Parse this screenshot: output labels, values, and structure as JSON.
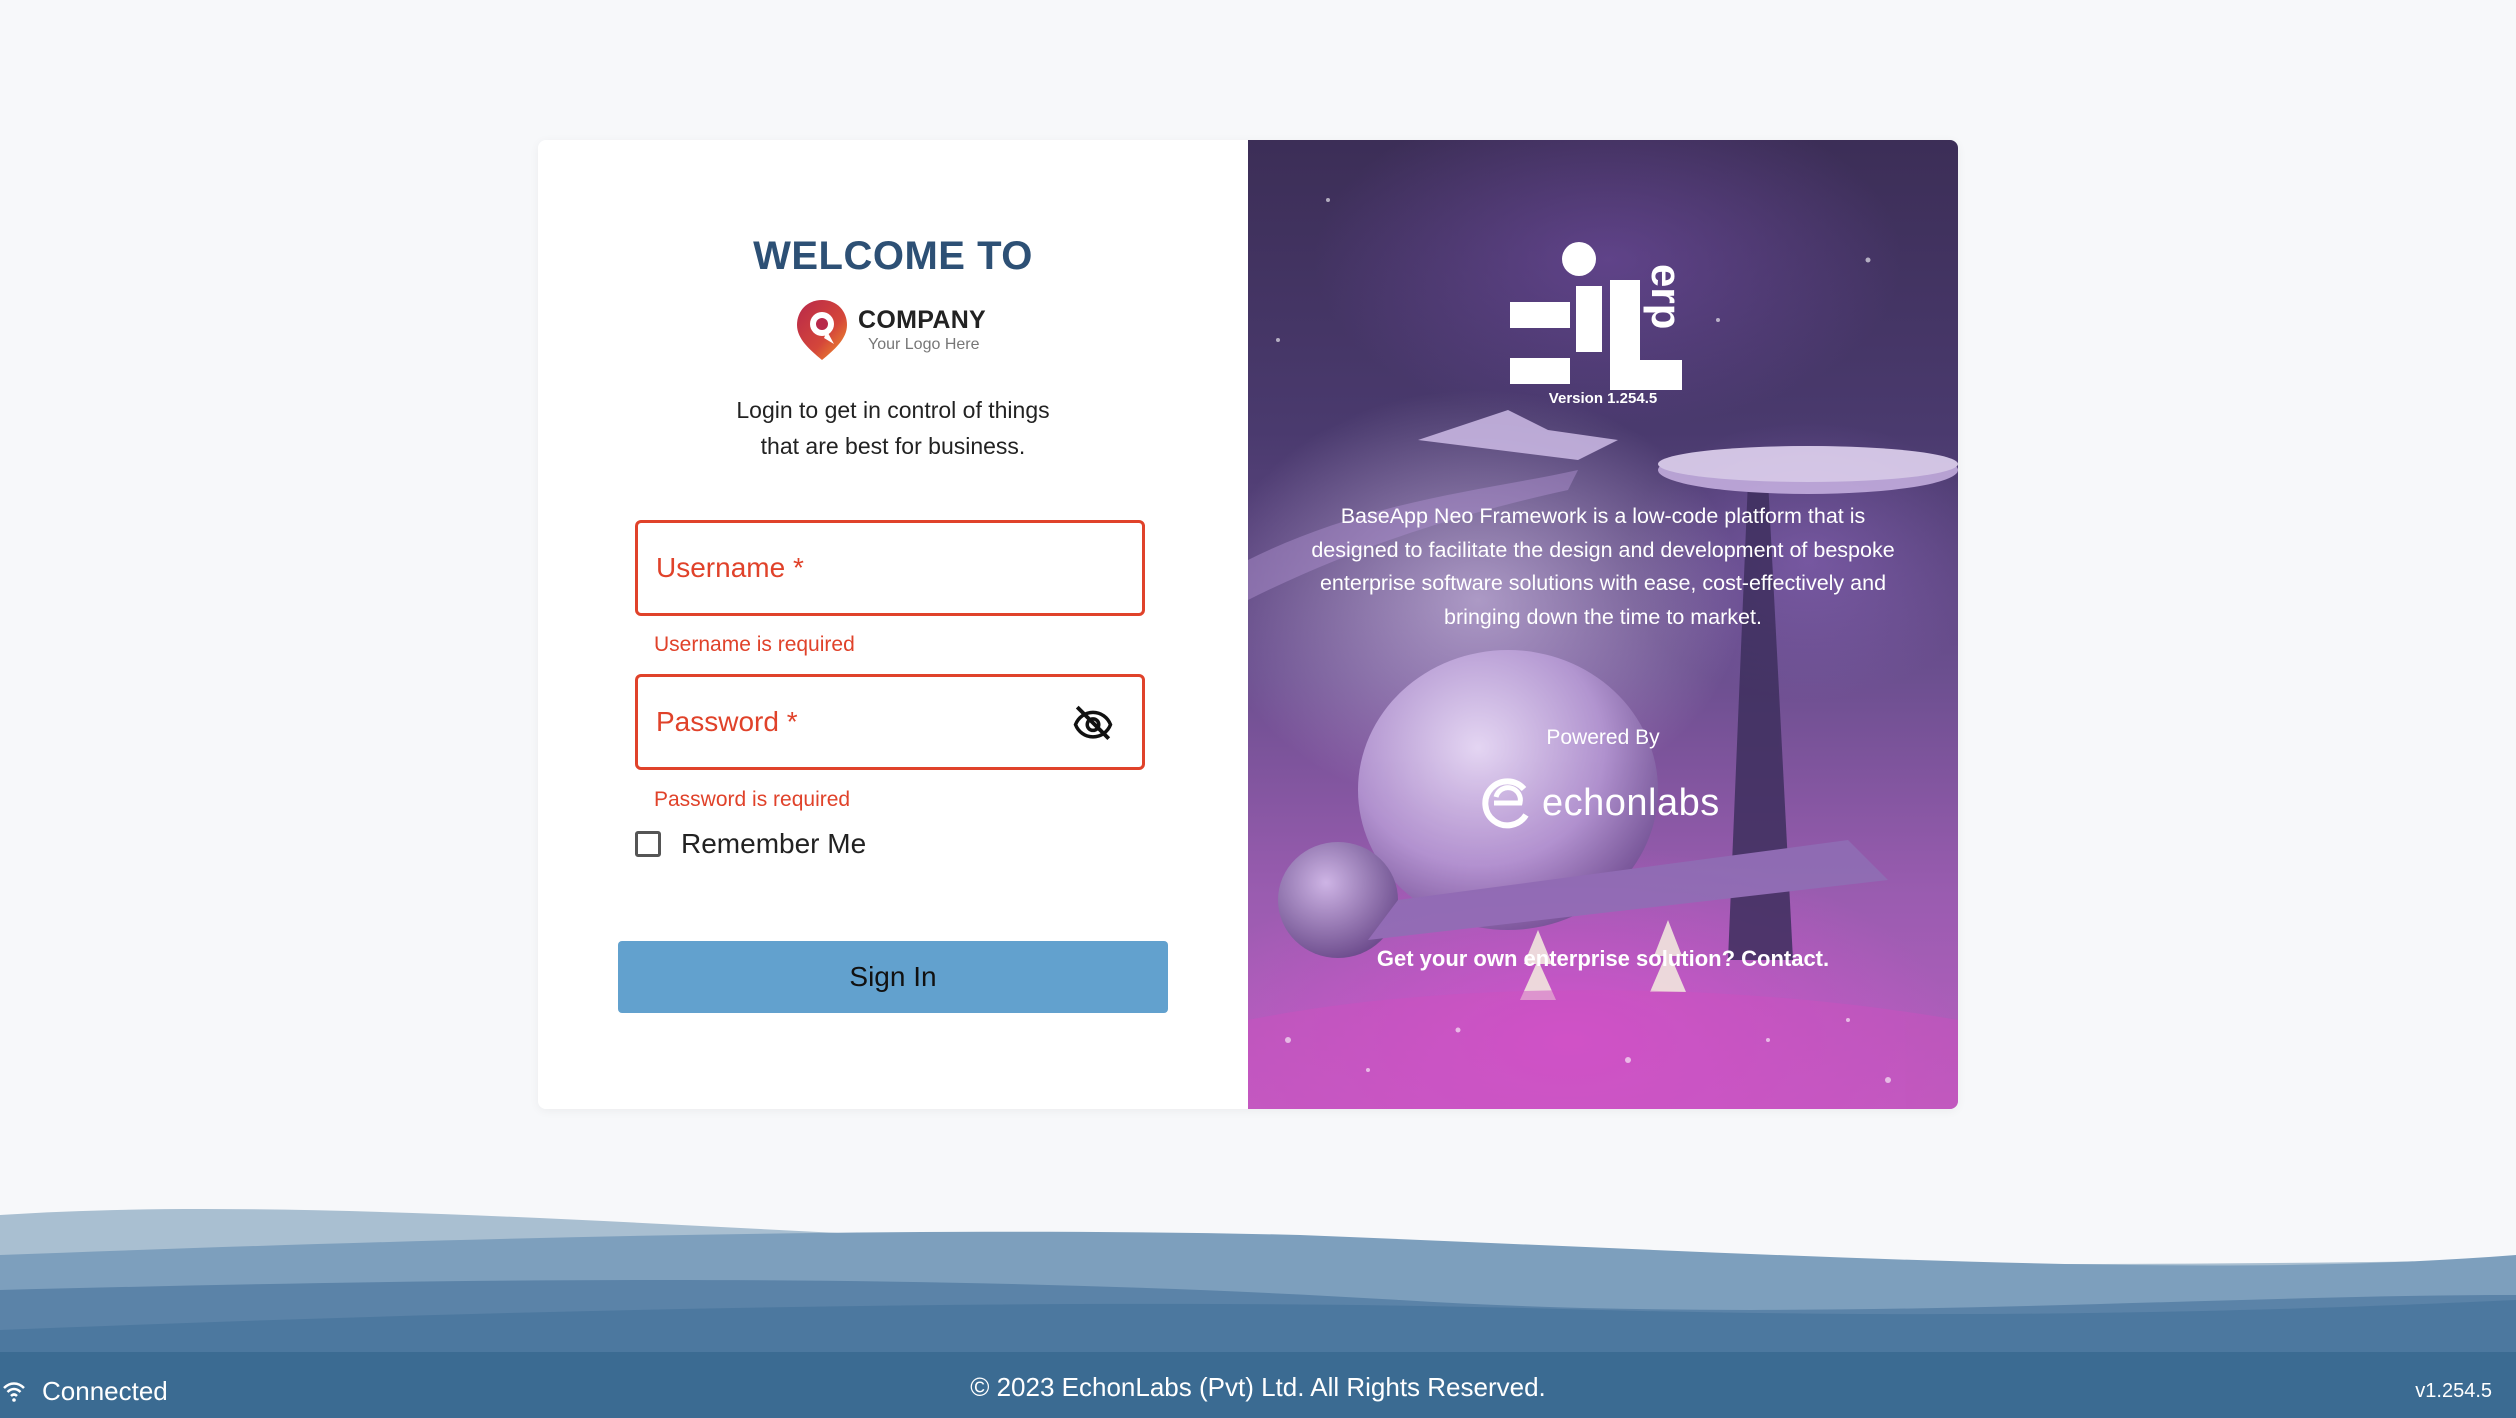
{
  "login": {
    "welcome": "WELCOME TO",
    "company_name": "COMPANY",
    "company_tagline": "Your Logo Here",
    "tagline_line1": "Login to get in control of things",
    "tagline_line2": "that are best for business.",
    "username_label": "Username *",
    "username_error": "Username is required",
    "password_label": "Password *",
    "password_error": "Password is required",
    "remember_label": "Remember Me",
    "remember_checked": false,
    "signin_label": "Sign In"
  },
  "promo": {
    "logo_text": "erp",
    "version": "Version 1.254.5",
    "description": "BaseApp Neo Framework is a low-code platform that is designed to facilitate the design and development of bespoke enterprise software solutions with ease, cost-effectively and bringing down the time to market.",
    "powered_by": "Powered By",
    "brand": "echonlabs",
    "contact": "Get your own enterprise solution? Contact."
  },
  "footer": {
    "status": "Connected",
    "copyright": "© 2023 EchonLabs (Pvt) Ltd. All Rights Reserved.",
    "version": "v1.254.5"
  },
  "colors": {
    "error": "#e0422a",
    "heading": "#2d5075",
    "button": "#62a1ce",
    "footer": "#3b6b92"
  }
}
